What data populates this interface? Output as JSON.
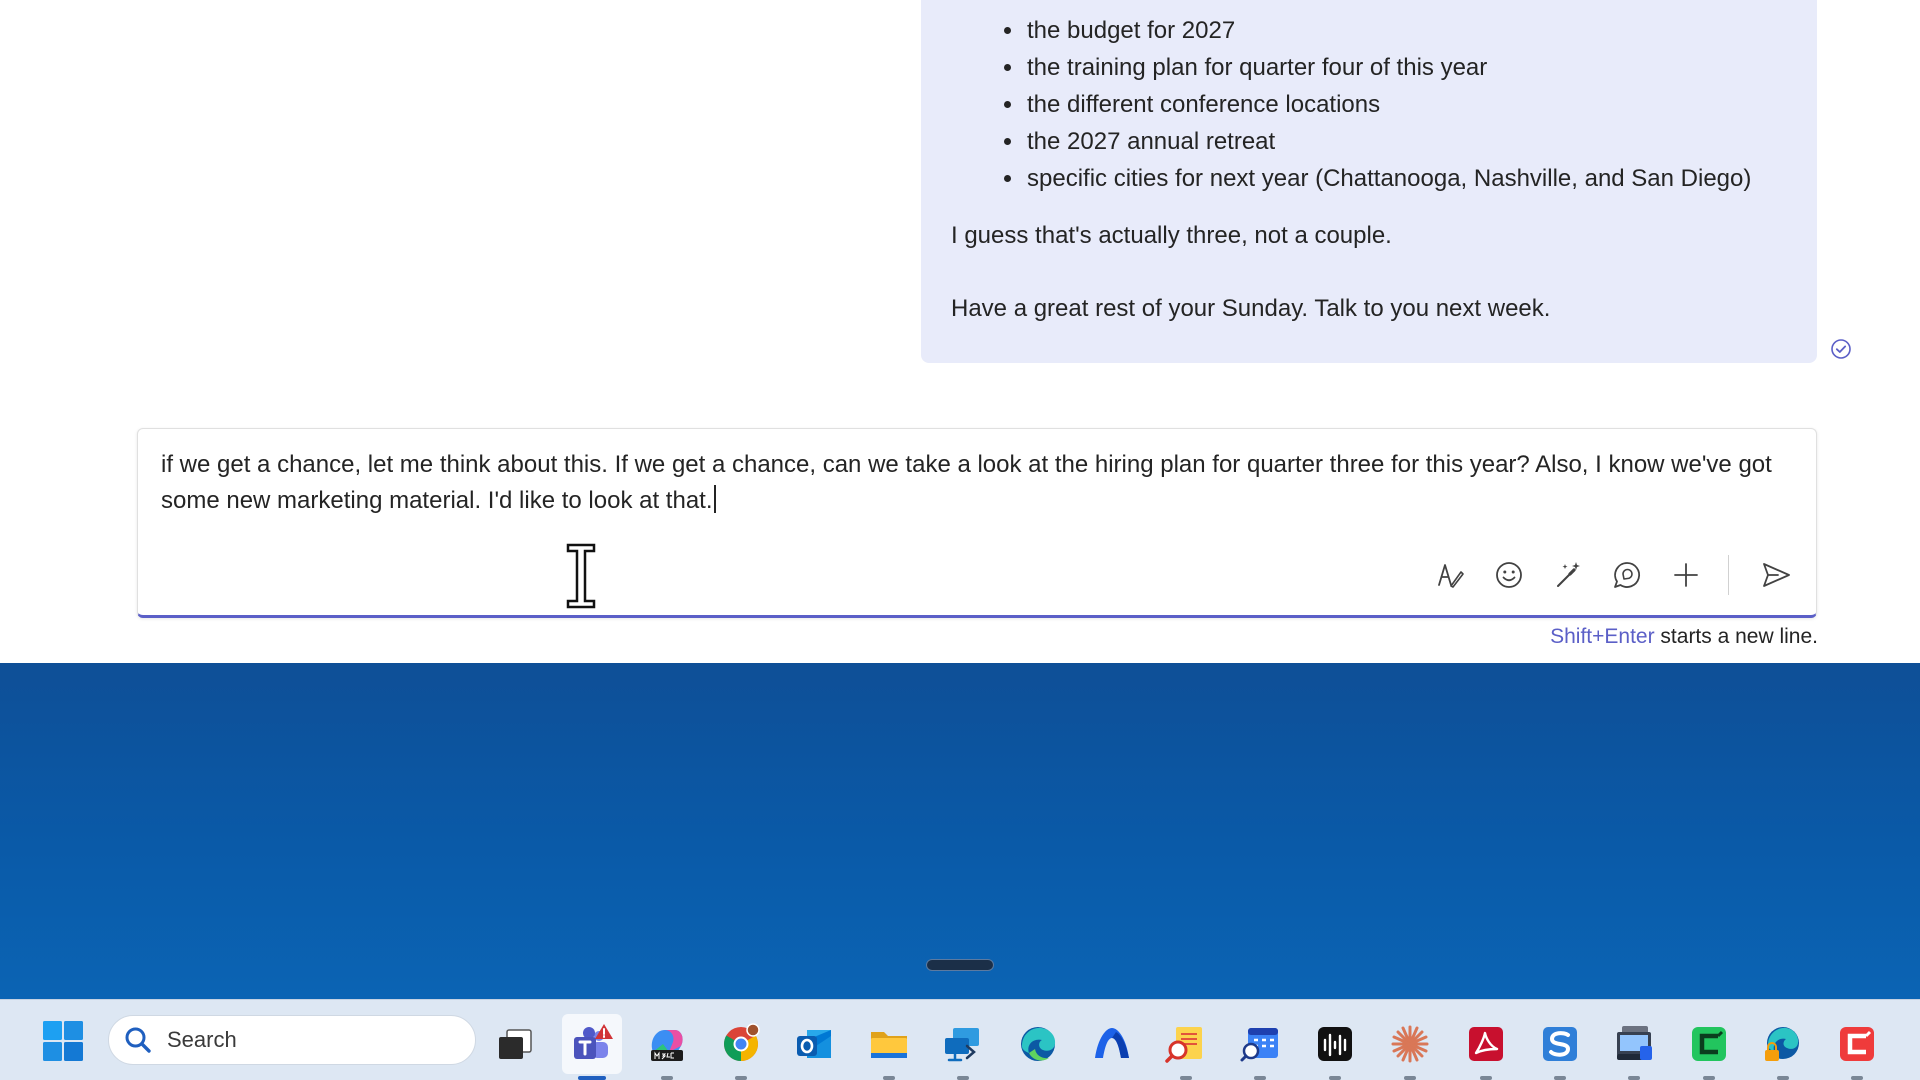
{
  "message": {
    "bullets": [
      "the budget for 2027",
      "the training plan for quarter four of this year",
      "the different conference locations",
      "the 2027 annual retreat",
      "specific cities for next year (Chattanooga, Nashville, and San Diego)"
    ],
    "line_1": "I guess that's actually three, not a couple.",
    "line_2": "Have a great rest of your Sunday. Talk to you next week."
  },
  "compose": {
    "text": "if we get a chance, let me think about this. If we get a chance, can we take a look at the hiring plan for quarter three for this year? Also, I know we've got some new marketing material. I'd like to look at that."
  },
  "hint": {
    "key": "Shift+Enter",
    "text": " starts a new line."
  },
  "taskbar": {
    "search_placeholder": "Search"
  },
  "colors": {
    "accent": "#5b5fc7",
    "bubble": "#e8ebfa",
    "desktop": "#0a5aa8",
    "taskbar": "#dde7f3"
  }
}
